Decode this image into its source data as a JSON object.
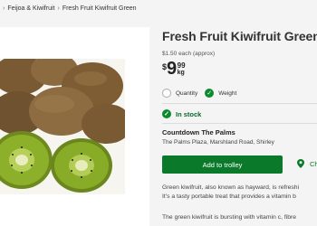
{
  "breadcrumb": {
    "items": [
      "Feijoa & Kiwifruit",
      "Fresh Fruit Kiwifruit Green"
    ],
    "separator": "›"
  },
  "product": {
    "title": "Fresh Fruit Kiwifruit Green",
    "each_price": "$1.50 each (approx)",
    "price": {
      "currency": "$",
      "main": "9",
      "cents": "99",
      "unit": "kg"
    },
    "unit_options": [
      {
        "label": "Quantity",
        "selected": false
      },
      {
        "label": "Weight",
        "selected": true
      }
    ],
    "stock_status": "In stock",
    "store_name": "Countdown The Palms",
    "store_address": "The Palms Plaza, Marshland Road, Shirley",
    "add_button": "Add to trolley",
    "change_store": "Ch",
    "description": [
      "Green kiwifruit, also known as hayward, is refreshi",
      "It's a tasty portable treat that provides a vitamin b",
      "The green kiwifruit is bursting with vitamin c, fibre"
    ]
  },
  "colors": {
    "brand_green": "#0a7a2a",
    "accent_green": "#0a8a2e"
  },
  "icons": {
    "check": "check-icon",
    "location": "location-pin-icon"
  }
}
